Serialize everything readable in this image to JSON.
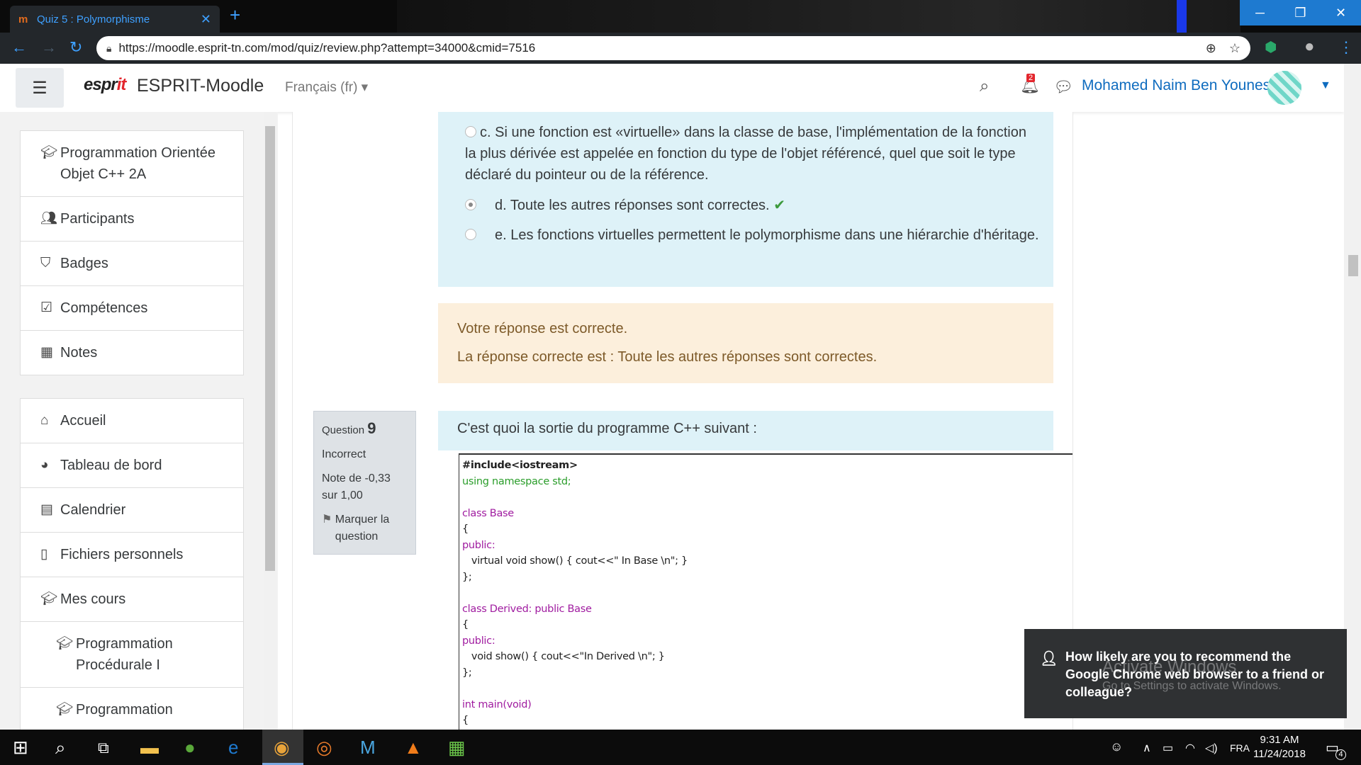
{
  "browser": {
    "tab_title": "Quiz 5 : Polymorphisme",
    "tab_favicon": "m",
    "close_tab": "✕",
    "new_tab": "+",
    "url": "https://moodle.esprit-tn.com/mod/quiz/review.php?attempt=34000&cmid=7516",
    "window_controls": {
      "minimize": "─",
      "maximize": "❐",
      "close": "✕"
    }
  },
  "navbar": {
    "logo_text_1": "espr",
    "logo_text_2": "it",
    "site_name": "ESPRIT-Moodle",
    "language": "Français (fr) ▾",
    "notification_count": "2",
    "user_name": "Mohamed Naim Ben Younes"
  },
  "drawer": {
    "course_section": [
      {
        "icon": "graduation-cap-icon",
        "label": "Programmation Orientée Objet C++ 2A"
      },
      {
        "icon": "users-icon",
        "label": "Participants"
      },
      {
        "icon": "shield-icon",
        "label": "Badges"
      },
      {
        "icon": "checkbox-icon",
        "label": "Compétences"
      },
      {
        "icon": "table-icon",
        "label": "Notes"
      }
    ],
    "site_section": [
      {
        "icon": "home-icon",
        "label": "Accueil"
      },
      {
        "icon": "dashboard-icon",
        "label": "Tableau de bord"
      },
      {
        "icon": "calendar-icon",
        "label": "Calendrier"
      },
      {
        "icon": "file-icon",
        "label": "Fichiers personnels"
      },
      {
        "icon": "graduation-cap-icon",
        "label": "Mes cours"
      },
      {
        "icon": "graduation-cap-icon",
        "label": "Programmation Procédurale I"
      },
      {
        "icon": "graduation-cap-icon",
        "label": "Programmation"
      }
    ]
  },
  "question8": {
    "options": [
      {
        "label": "c. Si une fonction est «virtuelle» dans la classe de base, l'implémentation de la fonction la plus dérivée est appelée en fonction du type de l'objet référencé, quel que soit le type déclaré du pointeur ou de la référence.",
        "selected": false
      },
      {
        "label": "d. Toute les autres réponses sont correctes.",
        "selected": true,
        "correct_mark": "✔"
      },
      {
        "label": "e. Les fonctions virtuelles permettent le polymorphisme dans une hiérarchie d'héritage.",
        "selected": false
      }
    ],
    "feedback": {
      "status": "Votre réponse est correcte.",
      "right_answer": "La réponse correcte est : Toute les autres réponses sont correctes."
    }
  },
  "question9": {
    "label": "Question",
    "number": "9",
    "state": "Incorrect",
    "grade": "Note de -0,33 sur 1,00",
    "flag": "Marquer la question",
    "text": "C'est quoi la sortie du programme C++ suivant :",
    "code_lines": [
      "#include<iostream>",
      "using namespace std;",
      "",
      "class Base",
      "{",
      "public:",
      "   virtual void show() { cout<<\" In Base \\n\"; }",
      "};",
      "",
      "class Derived: public Base",
      "{",
      "public:",
      "   void show() { cout<<\"In Derived \\n\"; }",
      "};",
      "",
      "int main(void)",
      "{"
    ]
  },
  "toast": {
    "text": "How likely are you to recommend the Google Chrome web browser to a friend or colleague?"
  },
  "watermark": {
    "title": "Activate Windows",
    "subtitle": "Go to Settings to activate Windows."
  },
  "taskbar": {
    "language": "FRA",
    "time": "9:31 AM",
    "date": "11/24/2018",
    "notif_count": "4"
  }
}
